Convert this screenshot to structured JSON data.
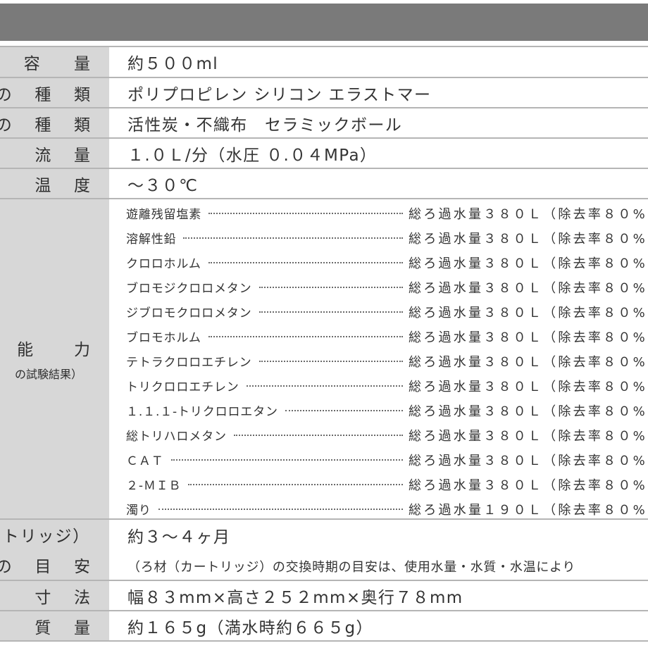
{
  "spec": {
    "rows": [
      {
        "label": "容　量",
        "value": "約５００ml"
      },
      {
        "label": "の 種 類",
        "value": "ポリプロピレン シリコン エラストマー"
      },
      {
        "label": "の 種 類",
        "value": "活性炭・不織布　セラミックボール"
      },
      {
        "label": "流 量",
        "value": "１.０Ｌ/分（水圧 ０.０４MPa）"
      },
      {
        "label": "温 度",
        "value": "～３０℃"
      }
    ],
    "capability": {
      "label_main": "能 力",
      "label_sub": "の試験結果）",
      "items": [
        {
          "name": "遊離残留塩素",
          "result": "総ろ過水量３８０Ｌ（除去率８０%"
        },
        {
          "name": "溶解性鉛",
          "result": "総ろ過水量３８０Ｌ（除去率８０%"
        },
        {
          "name": "クロロホルム",
          "result": "総ろ過水量３８０Ｌ（除去率８０%"
        },
        {
          "name": "ブロモジクロロメタン",
          "result": "総ろ過水量３８０Ｌ（除去率８０%"
        },
        {
          "name": "ジブロモクロロメタン",
          "result": "総ろ過水量３８０Ｌ（除去率８０%"
        },
        {
          "name": "ブロモホルム",
          "result": "総ろ過水量３８０Ｌ（除去率８０%"
        },
        {
          "name": "テトラクロロエチレン",
          "result": "総ろ過水量３８０Ｌ（除去率８０%"
        },
        {
          "name": "トリクロロエチレン",
          "result": "総ろ過水量３８０Ｌ（除去率８０%"
        },
        {
          "name": "１.１.１-トリクロロエタン",
          "result": "総ろ過水量３８０Ｌ（除去率８０%"
        },
        {
          "name": "総トリハロメタン",
          "result": "総ろ過水量３８０Ｌ（除去率８０%"
        },
        {
          "name": "ＣＡＴ",
          "result": "総ろ過水量３８０Ｌ（除去率８０%"
        },
        {
          "name": "２-ＭＩＢ",
          "result": "総ろ過水量３８０Ｌ（除去率８０%"
        },
        {
          "name": "濁り",
          "result": "総ろ過水量１９０Ｌ（除去率８０%"
        }
      ]
    },
    "cartridge": {
      "label_1": "トリッジ）",
      "label_2": "期 の 目 安",
      "value_1": "約３～４ヶ月",
      "value_2": "（ろ材（カートリッジ）の交換時期の目安は、使用水量・水質・水温により"
    },
    "bottom_rows": [
      {
        "label": "寸 法",
        "value": "幅８３mm×高さ２５２mm×奥行７８mm"
      },
      {
        "label": "質 量",
        "value": "約１６５g（満水時約６６５g）"
      }
    ]
  }
}
